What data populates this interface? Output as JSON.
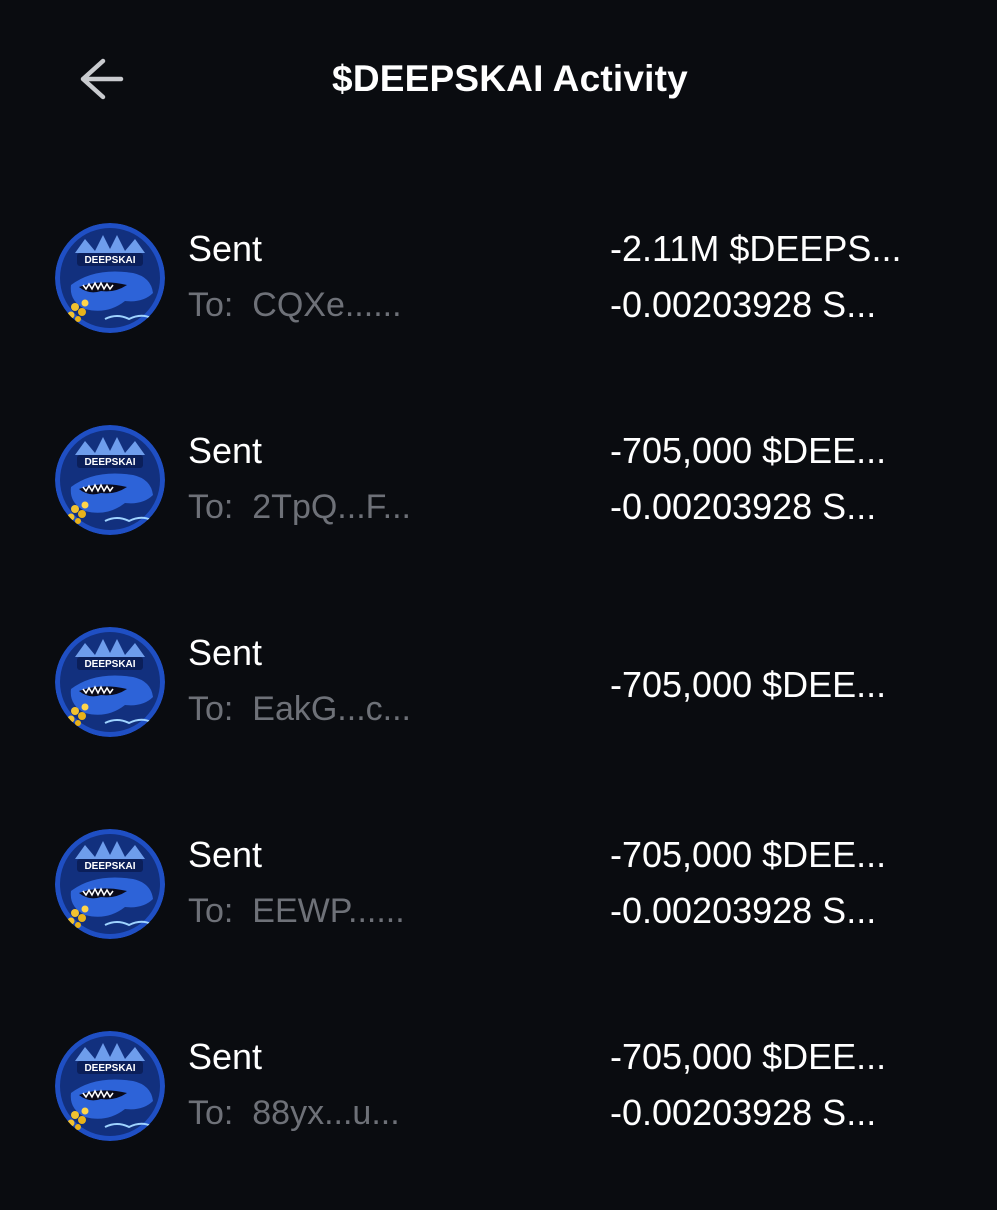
{
  "header": {
    "title": "$DEEPSKAI Activity",
    "back_icon": "arrow-left-icon"
  },
  "token": {
    "logo_text": "DEEPSKAI",
    "icon": "deepskai-whale-logo"
  },
  "colors": {
    "background": "#0a0c10",
    "primary_text": "#ffffff",
    "secondary_text": "#6e7178",
    "logo_blue": "#1f4fc4"
  },
  "activity": [
    {
      "type": "Sent",
      "to_label": "To:",
      "to_address": "CQXe......",
      "amount_token": "-2.11M $DEEPS...",
      "amount_fee": "-0.00203928 S..."
    },
    {
      "type": "Sent",
      "to_label": "To:",
      "to_address": "2TpQ...F...",
      "amount_token": "-705,000 $DEE...",
      "amount_fee": "-0.00203928 S..."
    },
    {
      "type": "Sent",
      "to_label": "To:",
      "to_address": "EakG...c...",
      "amount_token": "-705,000 $DEE...",
      "amount_fee": ""
    },
    {
      "type": "Sent",
      "to_label": "To:",
      "to_address": "EEWP......",
      "amount_token": "-705,000 $DEE...",
      "amount_fee": "-0.00203928 S..."
    },
    {
      "type": "Sent",
      "to_label": "To:",
      "to_address": "88yx...u...",
      "amount_token": "-705,000 $DEE...",
      "amount_fee": "-0.00203928 S..."
    }
  ]
}
